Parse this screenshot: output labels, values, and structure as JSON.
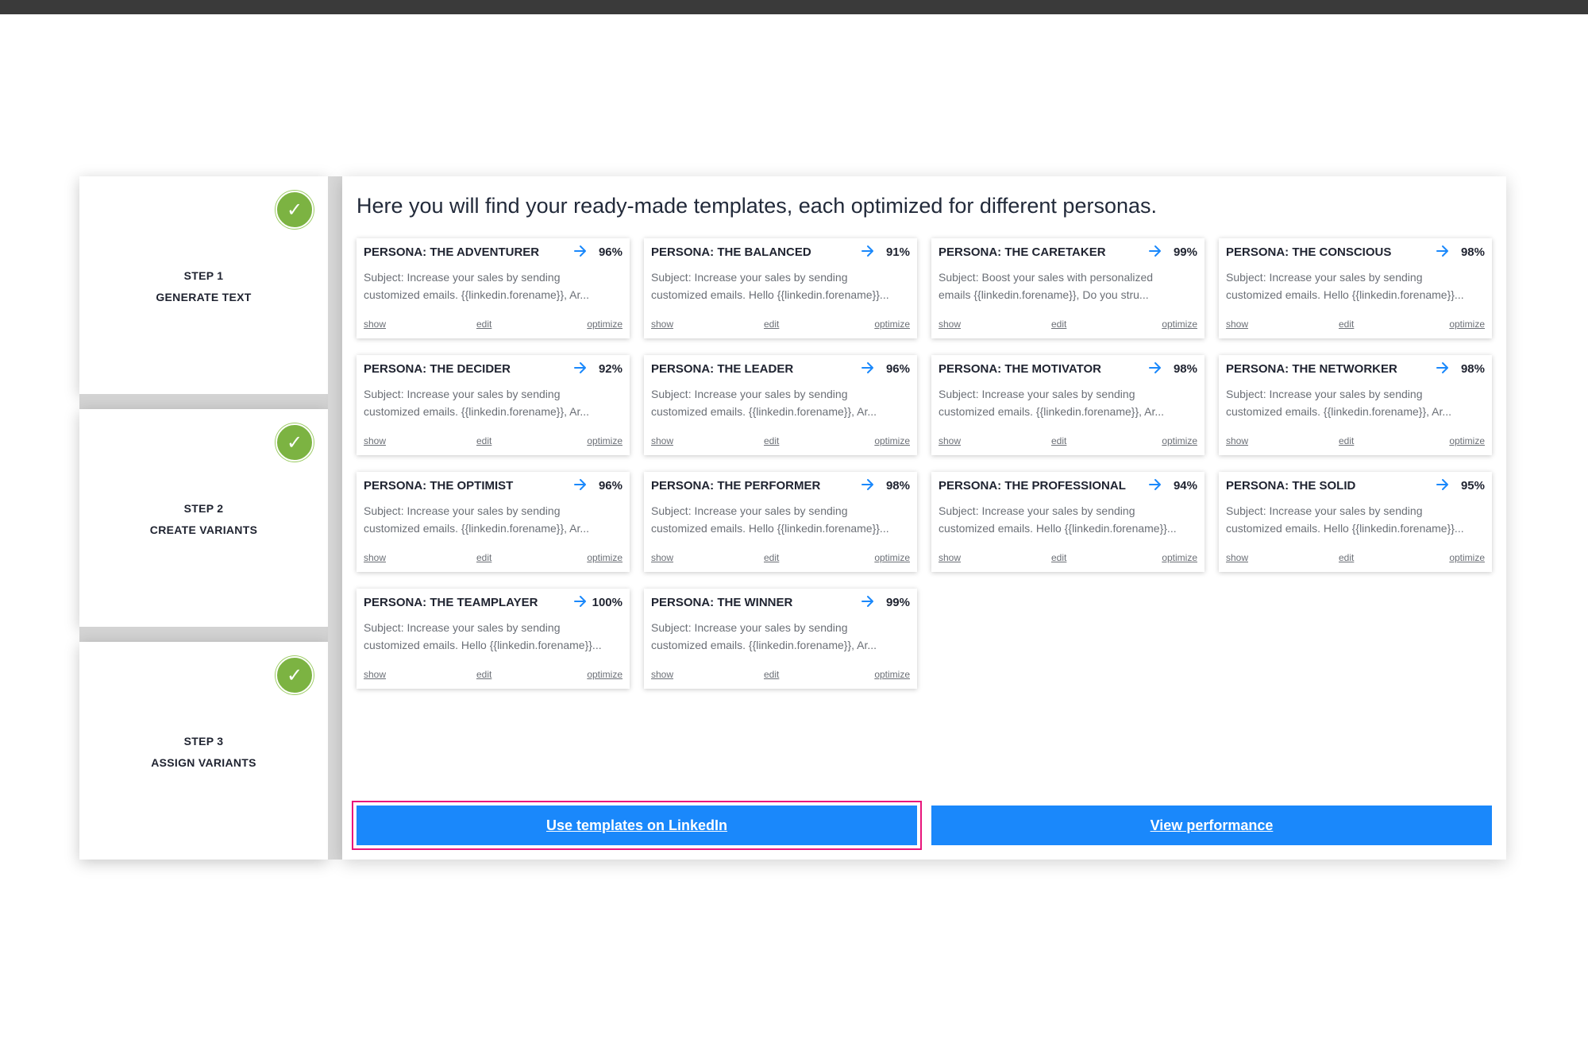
{
  "headline": "Here you will find your ready-made templates, each optimized for different personas.",
  "steps": [
    {
      "line1": "STEP 1",
      "line2": "GENERATE TEXT",
      "done_icon": "check-icon",
      "color": "#7cb342"
    },
    {
      "line1": "STEP 2",
      "line2": "CREATE VARIANTS",
      "done_icon": "check-icon",
      "color": "#7cb342"
    },
    {
      "line1": "STEP 3",
      "line2": "ASSIGN VARIANTS",
      "done_icon": "check-icon",
      "color": "#7cb342"
    }
  ],
  "cards": [
    {
      "title": "PERSONA: THE ADVENTURER",
      "score": "96%",
      "line1": "Subject: Increase your sales by sending",
      "line2": "customized emails. {{linkedin.forename}}, Ar...",
      "show": "show",
      "edit": "edit",
      "optimize": "optimize"
    },
    {
      "title": "PERSONA: THE BALANCED",
      "score": "91%",
      "line1": "Subject: Increase your sales by sending",
      "line2": "customized emails. Hello {{linkedin.forename}}...",
      "show": "show",
      "edit": "edit",
      "optimize": "optimize"
    },
    {
      "title": "PERSONA: THE CARETAKER",
      "score": "99%",
      "line1": "Subject: Boost your sales with personalized",
      "line2": "emails {{linkedin.forename}}, Do you stru...",
      "show": "show",
      "edit": "edit",
      "optimize": "optimize"
    },
    {
      "title": "PERSONA: THE CONSCIOUS",
      "score": "98%",
      "line1": "Subject: Increase your sales by sending",
      "line2": "customized emails. Hello {{linkedin.forename}}...",
      "show": "show",
      "edit": "edit",
      "optimize": "optimize"
    },
    {
      "title": "PERSONA: THE DECIDER",
      "score": "92%",
      "line1": "Subject: Increase your sales by sending",
      "line2": "customized emails. {{linkedin.forename}}, Ar...",
      "show": "show",
      "edit": "edit",
      "optimize": "optimize"
    },
    {
      "title": "PERSONA: THE LEADER",
      "score": "96%",
      "line1": "Subject: Increase your sales by sending",
      "line2": "customized emails. {{linkedin.forename}}, Ar...",
      "show": "show",
      "edit": "edit",
      "optimize": "optimize"
    },
    {
      "title": "PERSONA: THE MOTIVATOR",
      "score": "98%",
      "line1": "Subject: Increase your sales by sending",
      "line2": "customized emails. {{linkedin.forename}}, Ar...",
      "show": "show",
      "edit": "edit",
      "optimize": "optimize"
    },
    {
      "title": "PERSONA: THE NETWORKER",
      "score": "98%",
      "line1": "Subject: Increase your sales by sending",
      "line2": "customized emails. {{linkedin.forename}}, Ar...",
      "show": "show",
      "edit": "edit",
      "optimize": "optimize"
    },
    {
      "title": "PERSONA: THE OPTIMIST",
      "score": "96%",
      "line1": "Subject: Increase your sales by sending",
      "line2": "customized emails. {{linkedin.forename}}, Ar...",
      "show": "show",
      "edit": "edit",
      "optimize": "optimize"
    },
    {
      "title": "PERSONA: THE PERFORMER",
      "score": "98%",
      "line1": "Subject: Increase your sales by sending",
      "line2": "customized emails. Hello {{linkedin.forename}}...",
      "show": "show",
      "edit": "edit",
      "optimize": "optimize"
    },
    {
      "title": "PERSONA: THE PROFESSIONAL",
      "score": "94%",
      "line1": "Subject: Increase your sales by sending",
      "line2": "customized emails. Hello {{linkedin.forename}}...",
      "show": "show",
      "edit": "edit",
      "optimize": "optimize"
    },
    {
      "title": "PERSONA: THE SOLID",
      "score": "95%",
      "line1": "Subject: Increase your sales by sending",
      "line2": "customized emails. Hello {{linkedin.forename}}...",
      "show": "show",
      "edit": "edit",
      "optimize": "optimize"
    },
    {
      "title": "PERSONA: THE TEAMPLAYER",
      "score": "100%",
      "line1": "Subject: Increase your sales by sending",
      "line2": "customized emails. Hello {{linkedin.forename}}...",
      "show": "show",
      "edit": "edit",
      "optimize": "optimize"
    },
    {
      "title": "PERSONA: THE WINNER",
      "score": "99%",
      "line1": "Subject: Increase your sales by sending",
      "line2": "customized emails. {{linkedin.forename}}, Ar...",
      "show": "show",
      "edit": "edit",
      "optimize": "optimize"
    }
  ],
  "card_arrow_icon": "arrow-right-icon",
  "colors": {
    "accent": "#1a88fb",
    "highlight_outline": "#e8157a",
    "check": "#7cb342"
  },
  "buttons": {
    "linkedin": "Use templates on LinkedIn",
    "performance": "View performance"
  }
}
